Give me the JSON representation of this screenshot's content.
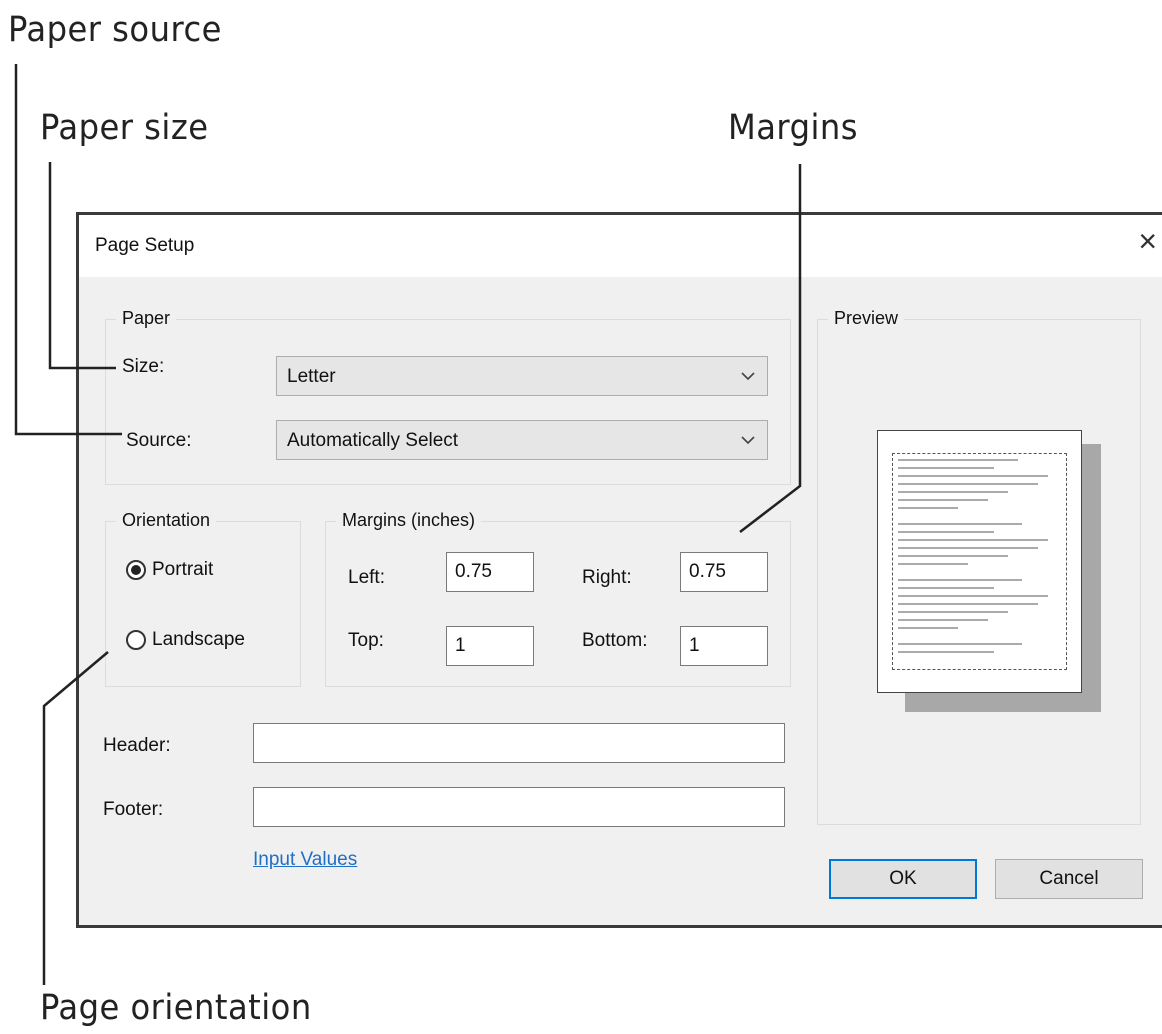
{
  "callouts": {
    "paper_source": "Paper source",
    "paper_size": "Paper size",
    "margins": "Margins",
    "page_orientation": "Page orientation"
  },
  "dialog": {
    "title": "Page Setup",
    "close_glyph": "×",
    "paper": {
      "legend": "Paper",
      "size_label": "Size:",
      "size_value": "Letter",
      "source_label": "Source:",
      "source_value": "Automatically Select"
    },
    "orientation": {
      "legend": "Orientation",
      "portrait_label": "Portrait",
      "landscape_label": "Landscape",
      "selected": "Portrait"
    },
    "margins": {
      "legend": "Margins (inches)",
      "left_label": "Left:",
      "left_value": "0.75",
      "right_label": "Right:",
      "right_value": "0.75",
      "top_label": "Top:",
      "top_value": "1",
      "bottom_label": "Bottom:",
      "bottom_value": "1"
    },
    "header_label": "Header:",
    "header_value": "",
    "footer_label": "Footer:",
    "footer_value": "",
    "input_values_link": "Input Values",
    "preview": {
      "legend": "Preview"
    },
    "buttons": {
      "ok": "OK",
      "cancel": "Cancel"
    }
  },
  "colors": {
    "dialog_bg": "#f0f0f0",
    "link": "#1f6fc4",
    "default_button_border": "#0078d7"
  }
}
